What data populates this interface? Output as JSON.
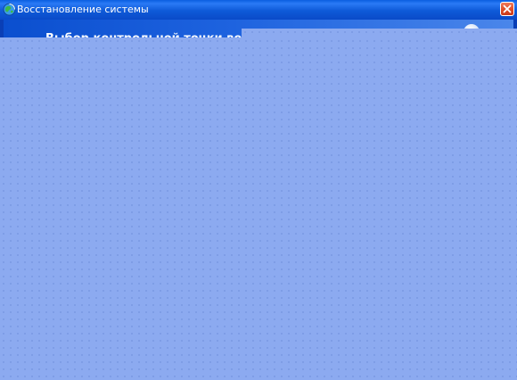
{
  "window": {
    "title": "Восстановление системы",
    "close_icon": "close-icon",
    "app_icon": "system-restore-icon"
  },
  "header": {
    "title": "Выбор контрольной точки во",
    "help_icon": "help-icon"
  },
  "colors": {
    "titlebar": "#0a5fe0",
    "content_background": "#8caaf0",
    "close_button": "#dd4a24"
  }
}
